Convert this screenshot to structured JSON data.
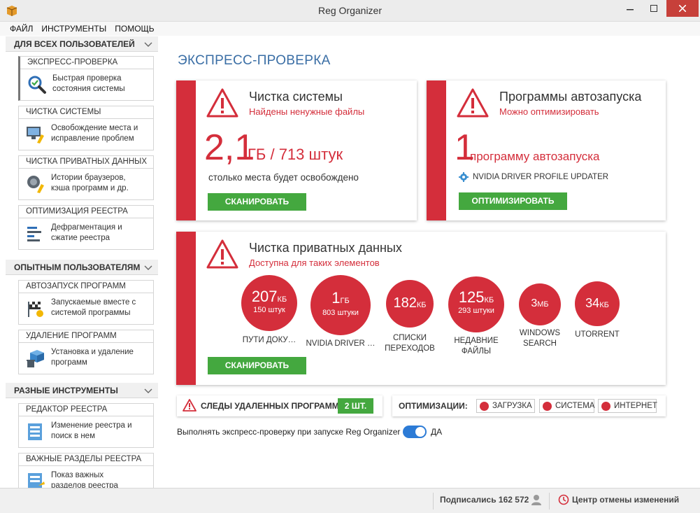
{
  "window": {
    "title": "Reg Organizer"
  },
  "menu": [
    "ФАЙЛ",
    "ИНСТРУМЕНТЫ",
    "ПОМОЩЬ"
  ],
  "sidebar": {
    "sections": [
      {
        "title": "ДЛЯ ВСЕХ ПОЛЬЗОВАТЕЛЕЙ"
      },
      {
        "title": "ОПЫТНЫМ ПОЛЬЗОВАТЕЛЯМ"
      },
      {
        "title": "РАЗНЫЕ ИНСТРУМЕНТЫ"
      }
    ],
    "items": [
      {
        "title": "ЭКСПРЕСС-ПРОВЕРКА",
        "line1": "Быстрая проверка",
        "line2": "состояния системы"
      },
      {
        "title": "ЧИСТКА СИСТЕМЫ",
        "line1": "Освобождение места и",
        "line2": "исправление проблем"
      },
      {
        "title": "ЧИСТКА ПРИВАТНЫХ ДАННЫХ",
        "line1": "Истории браузеров,",
        "line2": "кэша программ и др."
      },
      {
        "title": "ОПТИМИЗАЦИЯ РЕЕСТРА",
        "line1": "Дефрагментация и",
        "line2": "сжатие реестра"
      },
      {
        "title": "АВТОЗАПУСК ПРОГРАММ",
        "line1": "Запускаемые вместе с",
        "line2": "системой программы"
      },
      {
        "title": "УДАЛЕНИЕ ПРОГРАММ",
        "line1": "Установка и удаление",
        "line2": "программ"
      },
      {
        "title": "РЕДАКТОР РЕЕСТРА",
        "line1": "Изменение реестра и",
        "line2": "поиск в нем"
      },
      {
        "title": "ВАЖНЫЕ РАЗДЕЛЫ РЕЕСТРА",
        "line1": "Показ важных",
        "line2": "разделов реестра"
      }
    ]
  },
  "main": {
    "title": "ЭКСПРЕСС-ПРОВЕРКА",
    "cleanup": {
      "title": "Чистка системы",
      "subtitle": "Найдены ненужные файлы",
      "big_value": "2,1",
      "unit_text": "ГБ / 713 штук",
      "description": "столько места будет освобождено",
      "button": "СКАНИРОВАТЬ"
    },
    "autorun": {
      "title": "Программы автозапуска",
      "subtitle": "Можно оптимизировать",
      "big_value": "1",
      "unit_text": "программу автозапуска",
      "item": "NVIDIA DRIVER PROFILE UPDATER",
      "button": "ОПТИМИЗИРОВАТЬ"
    },
    "privacy": {
      "title": "Чистка приватных данных",
      "subtitle": "Доступна для таких элементов",
      "button": "СКАНИРОВАТЬ",
      "bubbles": [
        {
          "value": "207",
          "unit": "КБ",
          "count": "150 штук",
          "label1": "ПУТИ ДОКУ…",
          "label2": ""
        },
        {
          "value": "1",
          "unit": "ГБ",
          "count": "803 штуки",
          "label1": "NVIDIA DRIVER …",
          "label2": ""
        },
        {
          "value": "182",
          "unit": "КБ",
          "count": "",
          "label1": "СПИСКИ",
          "label2": "ПЕРЕХОДОВ"
        },
        {
          "value": "125",
          "unit": "КБ",
          "count": "293 штуки",
          "label1": "НЕДАВНИЕ",
          "label2": "ФАЙЛЫ"
        },
        {
          "value": "3",
          "unit": "МБ",
          "count": "",
          "label1": "WINDOWS",
          "label2": "SEARCH"
        },
        {
          "value": "34",
          "unit": "КБ",
          "count": "",
          "label1": "UTORRENT",
          "label2": ""
        }
      ]
    },
    "traces": {
      "label": "СЛЕДЫ УДАЛЕННЫХ ПРОГРАММ",
      "count_button": "2 ШТ."
    },
    "optimizations": {
      "label": "ОПТИМИЗАЦИИ:",
      "buttons": [
        "ЗАГРУЗКА",
        "СИСТЕМА",
        "ИНТЕРНЕТ"
      ]
    },
    "startup_check": {
      "label": "Выполнять экспресс-проверку при запуске Reg Organizer",
      "state": "ДА"
    }
  },
  "status": {
    "subscribers": "Подписались 162 572",
    "undo_center": "Центр отмены изменений"
  },
  "colors": {
    "accent_red": "#d42e3b",
    "green": "#44a83f",
    "title_blue": "#3a6ea5",
    "toggle_blue": "#2c7bd6"
  }
}
